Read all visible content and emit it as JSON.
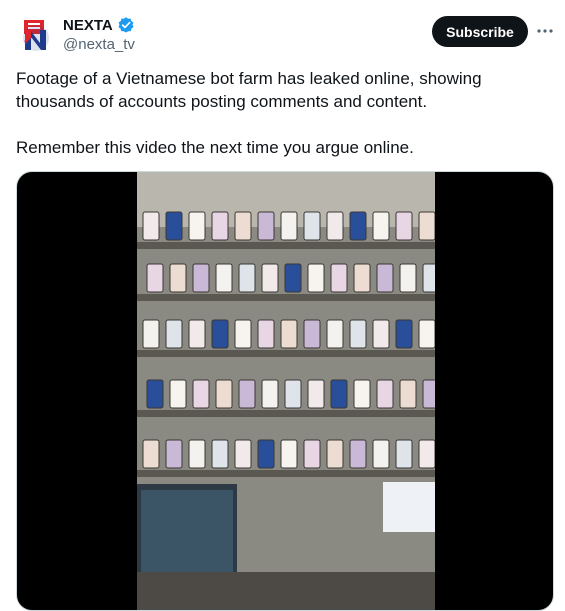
{
  "author": {
    "display_name": "NEXTA",
    "handle": "@nexta_tv",
    "verified": true,
    "avatar_icon": "nexta-logo-icon",
    "avatar_colors": {
      "red": "#e0242d",
      "blue": "#1f3c8c"
    }
  },
  "actions": {
    "subscribe_label": "Subscribe",
    "more_icon": "more-dots-icon"
  },
  "post": {
    "paragraphs": [
      "Footage of a Vietnamese bot farm has leaked online, showing thousands of accounts posting comments and content.",
      "Remember this video the next time you argue online."
    ]
  },
  "media": {
    "type": "video",
    "subject": "racks of smartphones on shelves"
  },
  "colors": {
    "verified_badge": "#1d9bf0",
    "text": "#0f1419",
    "muted": "#536471",
    "button_bg": "#0f1419"
  }
}
